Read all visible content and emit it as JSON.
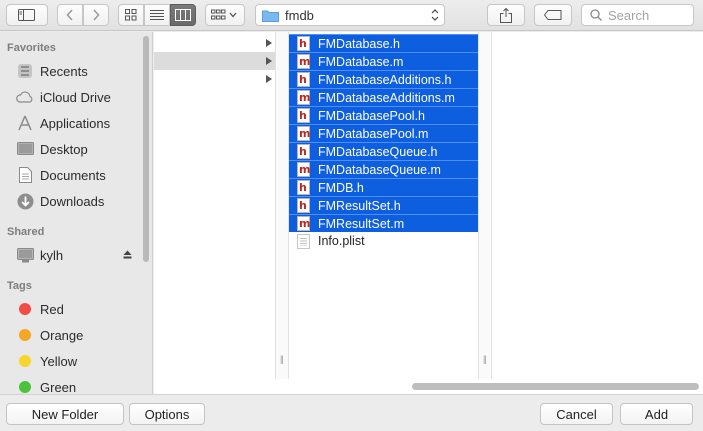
{
  "toolbar": {
    "path_label": "fmdb",
    "search_placeholder": "Search"
  },
  "sidebar": {
    "favorites_heading": "Favorites",
    "favorites": [
      {
        "label": "Recents",
        "icon": "clock-icon"
      },
      {
        "label": "iCloud Drive",
        "icon": "cloud-icon"
      },
      {
        "label": "Applications",
        "icon": "applications-icon"
      },
      {
        "label": "Desktop",
        "icon": "desktop-icon"
      },
      {
        "label": "Documents",
        "icon": "document-icon"
      },
      {
        "label": "Downloads",
        "icon": "download-icon"
      }
    ],
    "shared_heading": "Shared",
    "shared": [
      {
        "label": "kylh",
        "icon": "computer-icon"
      }
    ],
    "tags_heading": "Tags",
    "tags": [
      {
        "label": "Red",
        "color": "#f24c49"
      },
      {
        "label": "Orange",
        "color": "#f5a623"
      },
      {
        "label": "Yellow",
        "color": "#f7d52a"
      },
      {
        "label": "Green",
        "color": "#4bc23c"
      }
    ]
  },
  "browser": {
    "files": [
      {
        "name": "FMDatabase.h",
        "kind": "h",
        "selected": true
      },
      {
        "name": "FMDatabase.m",
        "kind": "m",
        "selected": true
      },
      {
        "name": "FMDatabaseAdditions.h",
        "kind": "h",
        "selected": true
      },
      {
        "name": "FMDatabaseAdditions.m",
        "kind": "m",
        "selected": true
      },
      {
        "name": "FMDatabasePool.h",
        "kind": "h",
        "selected": true
      },
      {
        "name": "FMDatabasePool.m",
        "kind": "m",
        "selected": true
      },
      {
        "name": "FMDatabaseQueue.h",
        "kind": "h",
        "selected": true
      },
      {
        "name": "FMDatabaseQueue.m",
        "kind": "m",
        "selected": true
      },
      {
        "name": "FMDB.h",
        "kind": "h",
        "selected": true
      },
      {
        "name": "FMResultSet.h",
        "kind": "h",
        "selected": true
      },
      {
        "name": "FMResultSet.m",
        "kind": "m",
        "selected": true
      },
      {
        "name": "Info.plist",
        "kind": "plist",
        "selected": false
      }
    ]
  },
  "buttons": {
    "new_folder": "New Folder",
    "options": "Options",
    "cancel": "Cancel",
    "add": "Add"
  },
  "colors": {
    "selection": "#0e5ee0",
    "header_file_letter": "#c0261f"
  }
}
